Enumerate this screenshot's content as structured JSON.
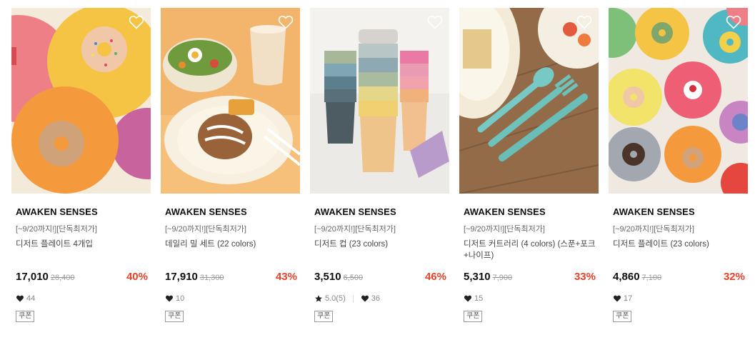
{
  "products": [
    {
      "brand": "AWAKEN SENSES",
      "promo": "[~9/20까지!][단독최저가]",
      "name": "디저트 플레이트 4개입",
      "price": "17,010",
      "original_price": "28,400",
      "discount": "40%",
      "likes": "44",
      "rating": null,
      "badge": "쿠폰",
      "image": "donut-plates"
    },
    {
      "brand": "AWAKEN SENSES",
      "promo": "[~9/20까지!][단독최저가]",
      "name": "데일리 밀 세트 (22 colors)",
      "price": "17,910",
      "original_price": "31,300",
      "discount": "43%",
      "likes": "10",
      "rating": null,
      "badge": "쿠폰",
      "image": "meal-set"
    },
    {
      "brand": "AWAKEN SENSES",
      "promo": "[~9/20까지!][단독최저가]",
      "name": "디저트 컵 (23 colors)",
      "price": "3,510",
      "original_price": "6,500",
      "discount": "46%",
      "likes": "36",
      "rating": "5.0(5)",
      "badge": "쿠폰",
      "image": "stacked-cups"
    },
    {
      "brand": "AWAKEN SENSES",
      "promo": "[~9/20까지!][단독최저가]",
      "name": "디저트 커트러리 (4 colors) (스푼+포크+나이프)",
      "price": "5,310",
      "original_price": "7,900",
      "discount": "33%",
      "likes": "15",
      "rating": null,
      "badge": "쿠폰",
      "image": "cutlery"
    },
    {
      "brand": "AWAKEN SENSES",
      "promo": "[~9/20까지!][단독최저가]",
      "name": "디저트 플레이트 (23 colors)",
      "price": "4,860",
      "original_price": "7,100",
      "discount": "32%",
      "likes": "17",
      "rating": null,
      "badge": "쿠폰",
      "image": "colorful-plates"
    }
  ],
  "icons": {
    "wishlist": "heart-outline-icon",
    "likes": "heart-filled-icon",
    "rating": "star-icon"
  },
  "colors": {
    "discount": "#e8432a",
    "price": "#111111",
    "muted": "#888888"
  }
}
